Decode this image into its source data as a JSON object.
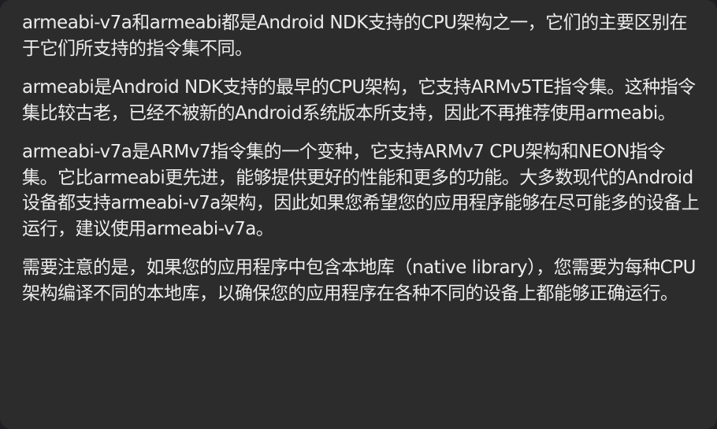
{
  "message": {
    "paragraphs": [
      "armeabi-v7a和armeabi都是Android NDK支持的CPU架构之一，它们的主要区别在于它们所支持的指令集不同。",
      "armeabi是Android NDK支持的最早的CPU架构，它支持ARMv5TE指令集。这种指令集比较古老，已经不被新的Android系统版本所支持，因此不再推荐使用armeabi。",
      "armeabi-v7a是ARMv7指令集的一个变种，它支持ARMv7 CPU架构和NEON指令集。它比armeabi更先进，能够提供更好的性能和更多的功能。大多数现代的Android设备都支持armeabi-v7a架构，因此如果您希望您的应用程序能够在尽可能多的设备上运行，建议使用armeabi-v7a。",
      "需要注意的是，如果您的应用程序中包含本地库（native library），您需要为每种CPU架构编译不同的本地库，以确保您的应用程序在各种不同的设备上都能够正确运行。"
    ]
  }
}
